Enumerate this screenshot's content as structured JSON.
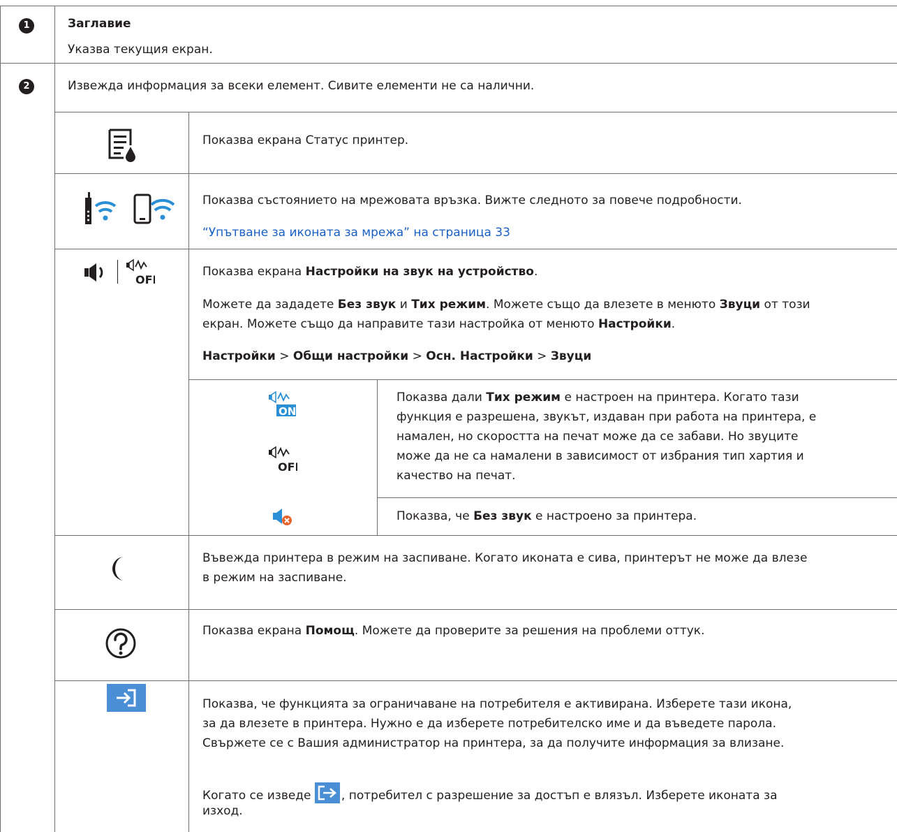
{
  "row1": {
    "number": "1",
    "title": "Заглавие",
    "desc": "Указва текущия екран."
  },
  "row2": {
    "number": "2",
    "intro": "Извежда информация за всеки елемент. Сивите елементи не са налични.",
    "items": {
      "printer_status": {
        "icon": "printer-ink-icon",
        "text": "Показва екрана Статус принтер."
      },
      "network": {
        "icons": [
          "wifi-printer-icon",
          "wifi-direct-icon"
        ],
        "text": "Показва състоянието на мрежовата връзка. Вижте следното за повече подробности.",
        "link": "“Упътване за иконата за мрежа” на страница 33"
      },
      "sound": {
        "icons": [
          "speaker-icon",
          "quiet-off-icon"
        ],
        "p1_pre": "Показва екрана ",
        "p1_bold": "Настройки на звук на устройство",
        "p1_post": ".",
        "p2_a": "Можете да зададете ",
        "p2_b": "Без звук",
        "p2_c": " и ",
        "p2_d": "Тих режим",
        "p2_e": ". Можете също да влезете в менюто ",
        "p2_f": "Звуци",
        "p2_g": " от този",
        "p2_h": "екран. Можете също да направите тази настройка от менюто ",
        "p2_i": "Настройки",
        "p2_j": ".",
        "path_1": "Настройки",
        "path_2": "Общи настройки",
        "path_3": "Осн. Настройки",
        "path_4": "Звуци",
        "sep": " > ",
        "quiet": {
          "l1_pre": "Показва дали ",
          "l1_bold": "Тих режим",
          "l1_post": " е настроен на принтера. Когато тази",
          "l2": "функция е разрешена, звукът, издаван при работа на принтера, е",
          "l3": "намален, но скоростта на печат може да се забави. Но звуците",
          "l4": "може да не са намалени в зависимост от избрания тип хартия и",
          "l5": "качество на печат."
        },
        "mute": {
          "pre": "Показва, че ",
          "bold": "Без звук",
          "post": " е настроено за принтера."
        }
      },
      "sleep": {
        "icon": "moon-icon",
        "l1": "Въвежда принтера в режим на заспиване. Когато иконата е сива, принтерът не може да влезе",
        "l2": "в режим на заспиване."
      },
      "help": {
        "icon": "help-icon",
        "pre": "Показва екрана ",
        "bold": "Помощ",
        "post": ". Можете да проверите за решения на проблеми оттук."
      },
      "login": {
        "icon": "login-icon",
        "l1": "Показва, че функцията за ограничаване на потребителя е активирана. Изберете тази икона,",
        "l2": "за да влезете в принтера. Нужно е да изберете потребителско име и да въведете парола.",
        "l3": "Свържете се с Вашия администратор на принтера, за да получите информация за влизане.",
        "l4_pre": "Когато се изведе ",
        "l4_post": ", потребител с разрешение за достъп е влязъл. Изберете иконата за",
        "l5": "изход."
      }
    }
  },
  "colors": {
    "link": "#1a5fc6",
    "icon_blue": "#2b8fd6",
    "login_bg": "#4a8ed6"
  }
}
